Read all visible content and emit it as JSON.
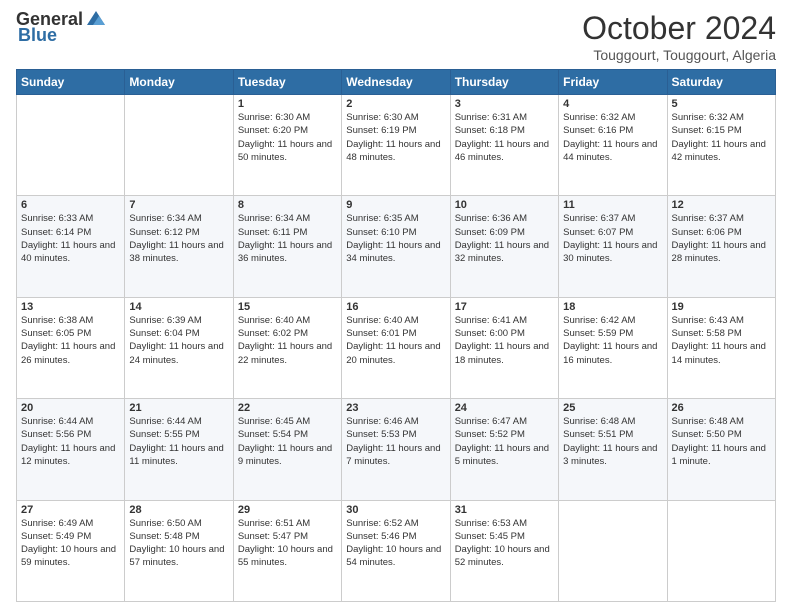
{
  "logo": {
    "general": "General",
    "blue": "Blue"
  },
  "title": "October 2024",
  "location": "Touggourt, Touggourt, Algeria",
  "days_of_week": [
    "Sunday",
    "Monday",
    "Tuesday",
    "Wednesday",
    "Thursday",
    "Friday",
    "Saturday"
  ],
  "weeks": [
    [
      {
        "day": "",
        "sunrise": "",
        "sunset": "",
        "daylight": ""
      },
      {
        "day": "",
        "sunrise": "",
        "sunset": "",
        "daylight": ""
      },
      {
        "day": "1",
        "sunrise": "Sunrise: 6:30 AM",
        "sunset": "Sunset: 6:20 PM",
        "daylight": "Daylight: 11 hours and 50 minutes."
      },
      {
        "day": "2",
        "sunrise": "Sunrise: 6:30 AM",
        "sunset": "Sunset: 6:19 PM",
        "daylight": "Daylight: 11 hours and 48 minutes."
      },
      {
        "day": "3",
        "sunrise": "Sunrise: 6:31 AM",
        "sunset": "Sunset: 6:18 PM",
        "daylight": "Daylight: 11 hours and 46 minutes."
      },
      {
        "day": "4",
        "sunrise": "Sunrise: 6:32 AM",
        "sunset": "Sunset: 6:16 PM",
        "daylight": "Daylight: 11 hours and 44 minutes."
      },
      {
        "day": "5",
        "sunrise": "Sunrise: 6:32 AM",
        "sunset": "Sunset: 6:15 PM",
        "daylight": "Daylight: 11 hours and 42 minutes."
      }
    ],
    [
      {
        "day": "6",
        "sunrise": "Sunrise: 6:33 AM",
        "sunset": "Sunset: 6:14 PM",
        "daylight": "Daylight: 11 hours and 40 minutes."
      },
      {
        "day": "7",
        "sunrise": "Sunrise: 6:34 AM",
        "sunset": "Sunset: 6:12 PM",
        "daylight": "Daylight: 11 hours and 38 minutes."
      },
      {
        "day": "8",
        "sunrise": "Sunrise: 6:34 AM",
        "sunset": "Sunset: 6:11 PM",
        "daylight": "Daylight: 11 hours and 36 minutes."
      },
      {
        "day": "9",
        "sunrise": "Sunrise: 6:35 AM",
        "sunset": "Sunset: 6:10 PM",
        "daylight": "Daylight: 11 hours and 34 minutes."
      },
      {
        "day": "10",
        "sunrise": "Sunrise: 6:36 AM",
        "sunset": "Sunset: 6:09 PM",
        "daylight": "Daylight: 11 hours and 32 minutes."
      },
      {
        "day": "11",
        "sunrise": "Sunrise: 6:37 AM",
        "sunset": "Sunset: 6:07 PM",
        "daylight": "Daylight: 11 hours and 30 minutes."
      },
      {
        "day": "12",
        "sunrise": "Sunrise: 6:37 AM",
        "sunset": "Sunset: 6:06 PM",
        "daylight": "Daylight: 11 hours and 28 minutes."
      }
    ],
    [
      {
        "day": "13",
        "sunrise": "Sunrise: 6:38 AM",
        "sunset": "Sunset: 6:05 PM",
        "daylight": "Daylight: 11 hours and 26 minutes."
      },
      {
        "day": "14",
        "sunrise": "Sunrise: 6:39 AM",
        "sunset": "Sunset: 6:04 PM",
        "daylight": "Daylight: 11 hours and 24 minutes."
      },
      {
        "day": "15",
        "sunrise": "Sunrise: 6:40 AM",
        "sunset": "Sunset: 6:02 PM",
        "daylight": "Daylight: 11 hours and 22 minutes."
      },
      {
        "day": "16",
        "sunrise": "Sunrise: 6:40 AM",
        "sunset": "Sunset: 6:01 PM",
        "daylight": "Daylight: 11 hours and 20 minutes."
      },
      {
        "day": "17",
        "sunrise": "Sunrise: 6:41 AM",
        "sunset": "Sunset: 6:00 PM",
        "daylight": "Daylight: 11 hours and 18 minutes."
      },
      {
        "day": "18",
        "sunrise": "Sunrise: 6:42 AM",
        "sunset": "Sunset: 5:59 PM",
        "daylight": "Daylight: 11 hours and 16 minutes."
      },
      {
        "day": "19",
        "sunrise": "Sunrise: 6:43 AM",
        "sunset": "Sunset: 5:58 PM",
        "daylight": "Daylight: 11 hours and 14 minutes."
      }
    ],
    [
      {
        "day": "20",
        "sunrise": "Sunrise: 6:44 AM",
        "sunset": "Sunset: 5:56 PM",
        "daylight": "Daylight: 11 hours and 12 minutes."
      },
      {
        "day": "21",
        "sunrise": "Sunrise: 6:44 AM",
        "sunset": "Sunset: 5:55 PM",
        "daylight": "Daylight: 11 hours and 11 minutes."
      },
      {
        "day": "22",
        "sunrise": "Sunrise: 6:45 AM",
        "sunset": "Sunset: 5:54 PM",
        "daylight": "Daylight: 11 hours and 9 minutes."
      },
      {
        "day": "23",
        "sunrise": "Sunrise: 6:46 AM",
        "sunset": "Sunset: 5:53 PM",
        "daylight": "Daylight: 11 hours and 7 minutes."
      },
      {
        "day": "24",
        "sunrise": "Sunrise: 6:47 AM",
        "sunset": "Sunset: 5:52 PM",
        "daylight": "Daylight: 11 hours and 5 minutes."
      },
      {
        "day": "25",
        "sunrise": "Sunrise: 6:48 AM",
        "sunset": "Sunset: 5:51 PM",
        "daylight": "Daylight: 11 hours and 3 minutes."
      },
      {
        "day": "26",
        "sunrise": "Sunrise: 6:48 AM",
        "sunset": "Sunset: 5:50 PM",
        "daylight": "Daylight: 11 hours and 1 minute."
      }
    ],
    [
      {
        "day": "27",
        "sunrise": "Sunrise: 6:49 AM",
        "sunset": "Sunset: 5:49 PM",
        "daylight": "Daylight: 10 hours and 59 minutes."
      },
      {
        "day": "28",
        "sunrise": "Sunrise: 6:50 AM",
        "sunset": "Sunset: 5:48 PM",
        "daylight": "Daylight: 10 hours and 57 minutes."
      },
      {
        "day": "29",
        "sunrise": "Sunrise: 6:51 AM",
        "sunset": "Sunset: 5:47 PM",
        "daylight": "Daylight: 10 hours and 55 minutes."
      },
      {
        "day": "30",
        "sunrise": "Sunrise: 6:52 AM",
        "sunset": "Sunset: 5:46 PM",
        "daylight": "Daylight: 10 hours and 54 minutes."
      },
      {
        "day": "31",
        "sunrise": "Sunrise: 6:53 AM",
        "sunset": "Sunset: 5:45 PM",
        "daylight": "Daylight: 10 hours and 52 minutes."
      },
      {
        "day": "",
        "sunrise": "",
        "sunset": "",
        "daylight": ""
      },
      {
        "day": "",
        "sunrise": "",
        "sunset": "",
        "daylight": ""
      }
    ]
  ]
}
